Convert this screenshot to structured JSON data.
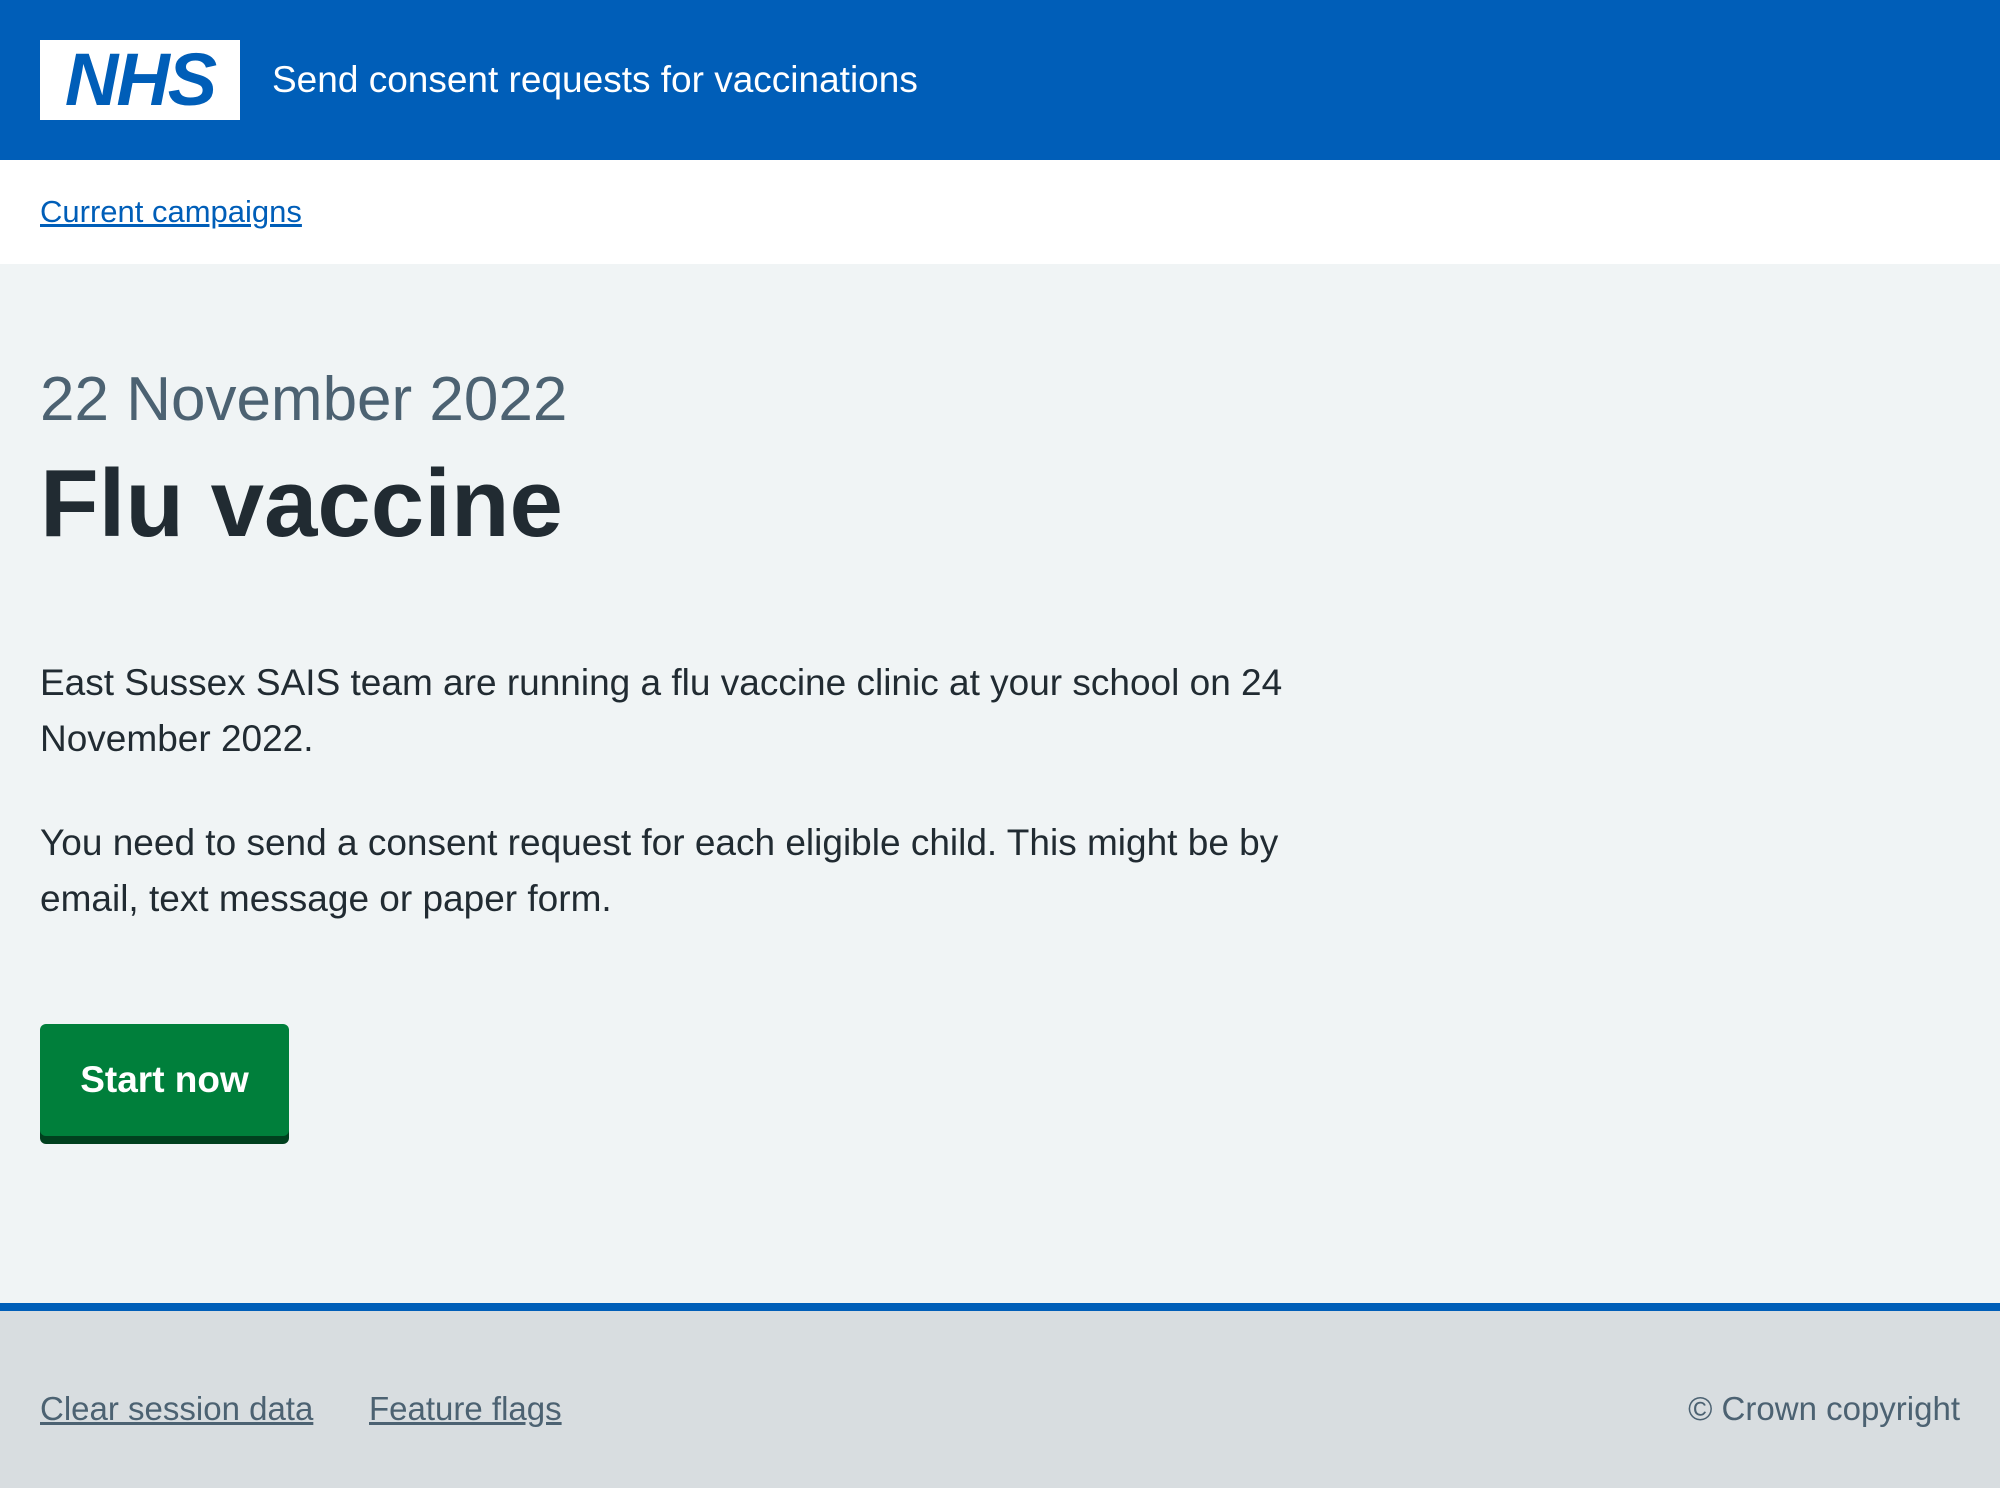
{
  "header": {
    "logo_text": "NHS",
    "service_name": "Send consent requests for vaccinations"
  },
  "breadcrumb": {
    "link_label": "Current campaigns"
  },
  "main": {
    "caption": "22 November 2022",
    "title": "Flu vaccine",
    "paragraphs": [
      "East Sussex SAIS team are running a flu vaccine clinic at your school on 24 November 2022.",
      "You need to send a consent request for each eligible child. This might be by email, text message or paper form."
    ],
    "start_button_label": "Start now"
  },
  "footer": {
    "links": [
      "Clear session data",
      "Feature flags"
    ],
    "copyright": "© Crown copyright"
  },
  "colors": {
    "brand_blue": "#005eb8",
    "button_green": "#007f3b",
    "page_background": "#f0f4f5",
    "footer_background": "#d8dde0",
    "secondary_text": "#4c6272"
  }
}
